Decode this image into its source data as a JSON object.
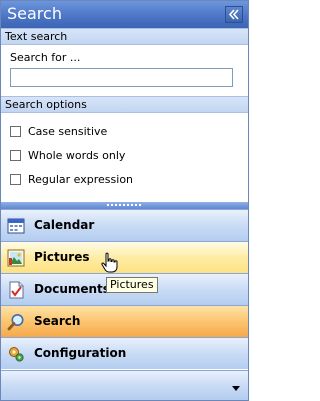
{
  "header": {
    "title": "Search"
  },
  "text_search": {
    "section_title": "Text search",
    "search_caption": "Search for ...",
    "search_value": "",
    "search_placeholder": ""
  },
  "search_options": {
    "section_title": "Search options",
    "options": [
      {
        "label": "Case sensitive",
        "checked": false
      },
      {
        "label": "Whole words only",
        "checked": false
      },
      {
        "label": "Regular expression",
        "checked": false
      }
    ]
  },
  "nav": {
    "items": [
      {
        "label": "Calendar",
        "icon": "calendar-icon",
        "state": "normal"
      },
      {
        "label": "Pictures",
        "icon": "pictures-icon",
        "state": "hover"
      },
      {
        "label": "Documents",
        "icon": "documents-icon",
        "state": "normal"
      },
      {
        "label": "Search",
        "icon": "magnifier-icon",
        "state": "selected"
      },
      {
        "label": "Configuration",
        "icon": "configuration-icon",
        "state": "normal"
      }
    ]
  },
  "tooltip": {
    "text": "Pictures"
  },
  "colors": {
    "header": "#4d76c6",
    "nav_blue": "#c9dbf5",
    "nav_hover": "#feeba0",
    "nav_selected": "#fbc570"
  }
}
